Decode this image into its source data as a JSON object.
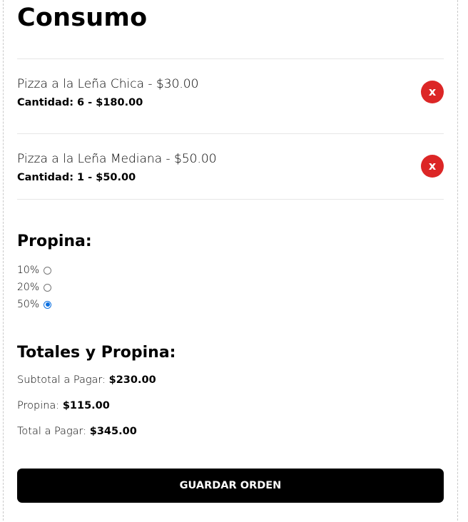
{
  "page": {
    "title": "Consumo"
  },
  "order": {
    "items": [
      {
        "name": "Pizza a la Leña Chica - $30.00",
        "quantity_line": "Cantidad: 6 - $180.00",
        "delete_label": "x"
      },
      {
        "name": "Pizza a la Leña Mediana - $50.00",
        "quantity_line": "Cantidad: 1 - $50.00",
        "delete_label": "x"
      }
    ]
  },
  "tip": {
    "title": "Propina:",
    "options": [
      {
        "label": "10%",
        "selected": false
      },
      {
        "label": "20%",
        "selected": false
      },
      {
        "label": "50%",
        "selected": true
      }
    ]
  },
  "totals": {
    "title": "Totales y Propina:",
    "subtotal_label": "Subtotal a Pagar:",
    "subtotal_value": "$230.00",
    "tip_label": "Propina:",
    "tip_value": "$115.00",
    "total_label": "Total a Pagar:",
    "total_value": "$345.00"
  },
  "actions": {
    "save_label": "GUARDAR ORDEN"
  },
  "colors": {
    "delete_button": "#dc2626",
    "radio_selected": "#0b6fe0",
    "primary_button": "#000000"
  }
}
